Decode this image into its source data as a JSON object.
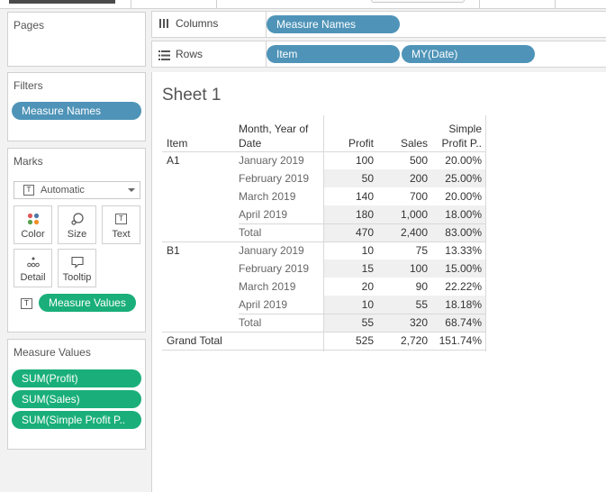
{
  "pages": {
    "title": "Pages"
  },
  "filters": {
    "title": "Filters",
    "pill": "Measure Names"
  },
  "marks": {
    "title": "Marks",
    "type": "Automatic",
    "buttons": {
      "color": "Color",
      "size": "Size",
      "text": "Text",
      "detail": "Detail",
      "tooltip": "Tooltip"
    },
    "text_pill": "Measure Values"
  },
  "measure_values": {
    "title": "Measure Values",
    "pills": [
      "SUM(Profit)",
      "SUM(Sales)",
      "SUM(Simple Profit P.."
    ]
  },
  "shelves": {
    "columns": {
      "label": "Columns",
      "pills": [
        "Measure Names"
      ]
    },
    "rows": {
      "label": "Rows",
      "pills": [
        "Item",
        "MY(Date)"
      ]
    }
  },
  "sheet": {
    "title": "Sheet 1"
  },
  "table": {
    "headers": {
      "item": "Item",
      "month_line1": "Month, Year of",
      "month_line2": "Date",
      "profit": "Profit",
      "sales": "Sales",
      "spp_line1": "Simple",
      "spp_line2": "Profit P.."
    },
    "groups": [
      {
        "item": "A1",
        "rows": [
          {
            "month": "January 2019",
            "profit": "100",
            "sales": "500",
            "spp": "20.00%"
          },
          {
            "month": "February 2019",
            "profit": "50",
            "sales": "200",
            "spp": "25.00%"
          },
          {
            "month": "March 2019",
            "profit": "140",
            "sales": "700",
            "spp": "20.00%"
          },
          {
            "month": "April 2019",
            "profit": "180",
            "sales": "1,000",
            "spp": "18.00%"
          }
        ],
        "total": {
          "label": "Total",
          "profit": "470",
          "sales": "2,400",
          "spp": "83.00%"
        }
      },
      {
        "item": "B1",
        "rows": [
          {
            "month": "January 2019",
            "profit": "10",
            "sales": "75",
            "spp": "13.33%"
          },
          {
            "month": "February 2019",
            "profit": "15",
            "sales": "100",
            "spp": "15.00%"
          },
          {
            "month": "March 2019",
            "profit": "20",
            "sales": "90",
            "spp": "22.22%"
          },
          {
            "month": "April 2019",
            "profit": "10",
            "sales": "55",
            "spp": "18.18%"
          }
        ],
        "total": {
          "label": "Total",
          "profit": "55",
          "sales": "320",
          "spp": "68.74%"
        }
      }
    ],
    "grand_total": {
      "label": "Grand Total",
      "profit": "525",
      "sales": "2,720",
      "spp": "151.74%"
    }
  }
}
